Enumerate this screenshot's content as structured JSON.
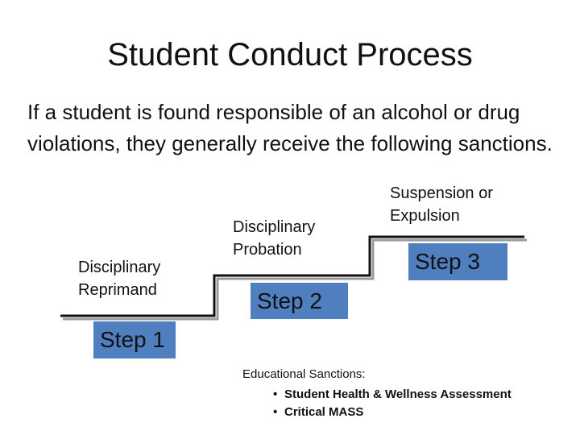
{
  "title": "Student Conduct Process",
  "intro": "If a student is found responsible of an alcohol or drug violations, they generally receive the following sanctions.",
  "steps": [
    {
      "label_line1": "Disciplinary",
      "label_line2": "Reprimand",
      "box": "Step 1"
    },
    {
      "label_line1": "Disciplinary",
      "label_line2": "Probation",
      "box": "Step 2"
    },
    {
      "label_line1": "Suspension or",
      "label_line2": "Expulsion",
      "box": "Step 3"
    }
  ],
  "educational": {
    "title": "Educational Sanctions:",
    "bullet": "•",
    "items": [
      "Student Health & Wellness Assessment",
      "Critical MASS"
    ]
  },
  "colors": {
    "step_box": "#4f7fbf",
    "text": "#111111",
    "background": "#ffffff"
  }
}
